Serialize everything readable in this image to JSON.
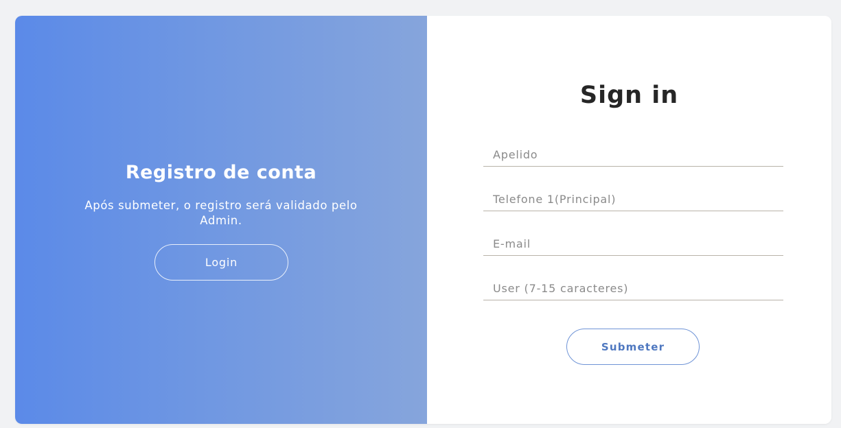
{
  "left_panel": {
    "title": "Registro de conta",
    "message": "Após submeter, o registro será validado pelo Admin.",
    "login_label": "Login"
  },
  "form": {
    "title": "Sign in",
    "fields": [
      {
        "placeholder": "Apelido",
        "value": ""
      },
      {
        "placeholder": "Telefone 1(Principal)",
        "value": ""
      },
      {
        "placeholder": "E-mail",
        "value": ""
      },
      {
        "placeholder": "User (7-15 caracteres)",
        "value": ""
      }
    ],
    "submit_label": "Submeter"
  },
  "colors": {
    "gradient_start": "#5b8ae8",
    "gradient_end": "#86a5dc",
    "accent": "#4f78c0",
    "background": "#f1f2f4"
  }
}
